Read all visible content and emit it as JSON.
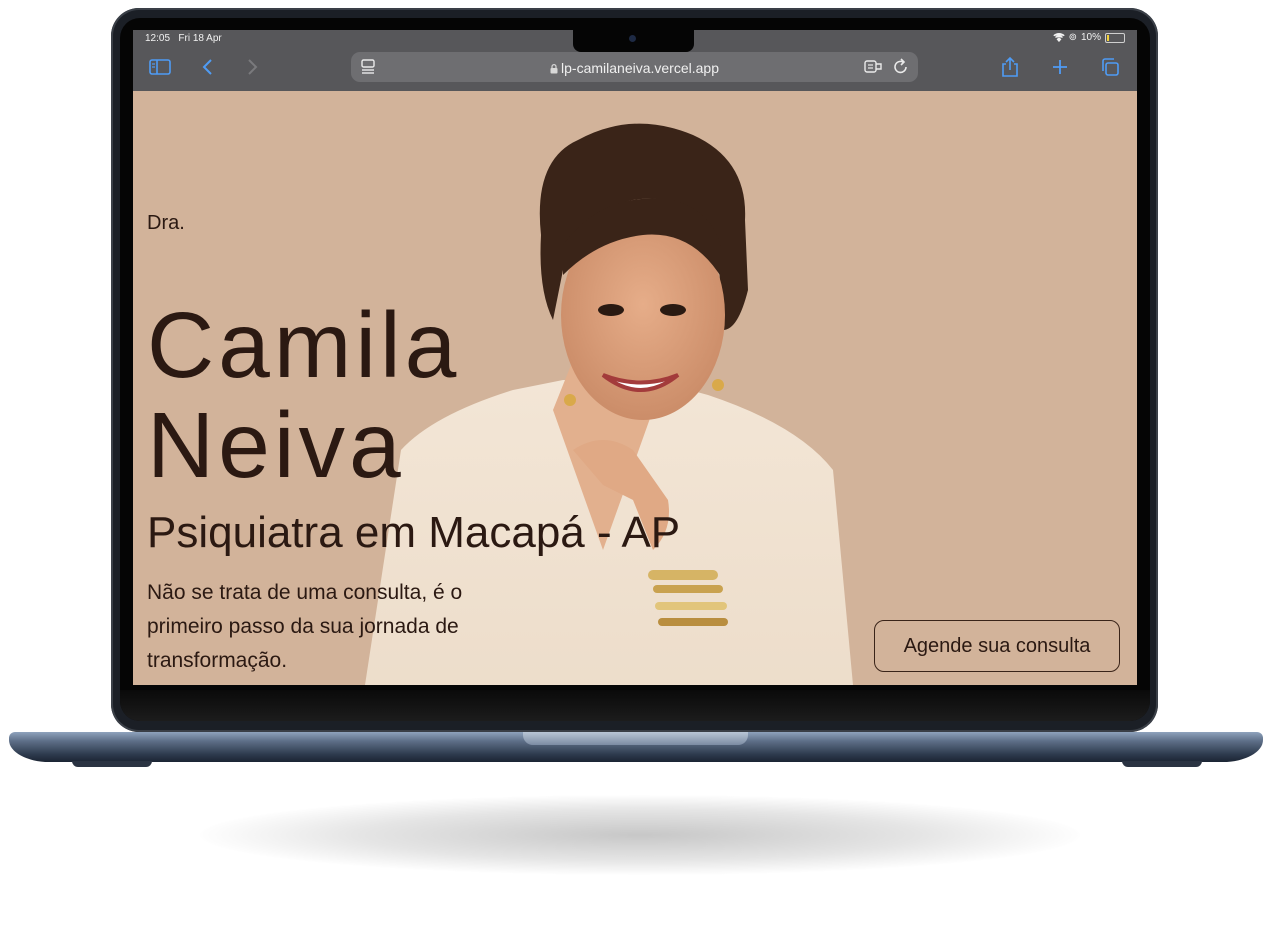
{
  "status_bar": {
    "time": "12:05",
    "date": "Fri 18 Apr",
    "battery": "10%"
  },
  "browser": {
    "url": "lp-camilaneiva.vercel.app",
    "icons": [
      "sidebar-icon",
      "back-icon",
      "forward-icon",
      "tab-overview-icon",
      "lock-icon",
      "reader-icon",
      "reload-icon",
      "share-icon",
      "plus-icon",
      "tabs-icon"
    ]
  },
  "hero": {
    "prefix": "Dra.",
    "first_name": "Camila",
    "last_name": "Neiva",
    "subtitle": "Psiquiatra em Macapá - AP",
    "description": "Não se trata de uma consulta, é o primeiro passo da sua jornada de transformação.",
    "cta_label": "Agende sua consulta"
  },
  "colors": {
    "page_background": "#d2b39a",
    "text": "#2b1912",
    "browser_chrome": "#57575a",
    "toolbar_accent": "#4f9cf5"
  }
}
